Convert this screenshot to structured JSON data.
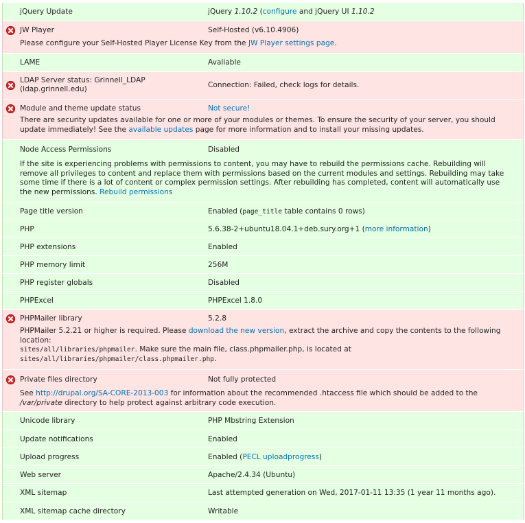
{
  "rows": [
    {
      "status": "ok",
      "title": "jQuery Update",
      "value_pre": "jQuery ",
      "value_em": "1.10.2",
      "value_link": "configure",
      "value_mid": " and jQuery UI ",
      "value_em2": "1.10.2",
      "value_open": " (",
      "value_close": ")"
    },
    {
      "status": "error",
      "title": "JW Player",
      "value": "Self-Hosted (v6.10.4906)",
      "desc_pre": "Please configure your Self-Hosted Player License Key from the ",
      "desc_link": "JW Player settings page",
      "desc_post": "."
    },
    {
      "status": "ok",
      "title": "LAME",
      "value": "Avaliable"
    },
    {
      "status": "error",
      "title_line1": "LDAP Server status: Grinnell_LDAP",
      "title_line2": "(ldap.grinnell.edu)",
      "value": "Connection: Failed, check logs for details."
    },
    {
      "status": "error",
      "title": "Module and theme update status",
      "value_link": "Not secure!",
      "desc_pre": "There are security updates available for one or more of your modules or themes. To ensure the security of your server, you should update immediately! See the ",
      "desc_link": "available updates",
      "desc_post": " page for more information and to install your missing updates."
    },
    {
      "status": "ok",
      "title": "Node Access Permissions",
      "value": "Disabled",
      "desc_pre": "If the site is experiencing problems with permissions to content, you may have to rebuild the permissions cache. Rebuilding will remove all privileges to content and replace them with permissions based on the current modules and settings. Rebuilding may take some time if there is a lot of content or complex permission settings. After rebuilding has completed, content will automatically use the new permissions. ",
      "desc_link": "Rebuild permissions"
    },
    {
      "status": "ok",
      "title": "Page title version",
      "value_pre": "Enabled (",
      "value_code": "page_title",
      "value_post": " table contains 0 rows)"
    },
    {
      "status": "ok",
      "title": "PHP",
      "value_pre": "5.6.38-2+ubuntu18.04.1+deb.sury.org+1 (",
      "value_link": "more information",
      "value_post": ")"
    },
    {
      "status": "ok",
      "title": "PHP extensions",
      "value": "Enabled"
    },
    {
      "status": "ok",
      "title": "PHP memory limit",
      "value": "256M"
    },
    {
      "status": "ok",
      "title": "PHP register globals",
      "value": "Disabled"
    },
    {
      "status": "ok",
      "title": "PHPExcel",
      "value": "PHPExcel 1.8.0"
    },
    {
      "status": "error",
      "title": "PHPMailer library",
      "value": "5.2.8",
      "desc_pre": "PHPMailer 5.2.21 or higher is required. Please ",
      "desc_link": "download the new version",
      "desc_post": ", extract the archive and copy the contents to the following location:",
      "desc_code1": "sites/all/libraries/phpmailer",
      "desc_mid": ". Make sure the main file, class.phpmailer.php, is located at",
      "desc_code2": "sites/all/libraries/phpmailer/class.phpmailer.php",
      "desc_end": "."
    },
    {
      "status": "error",
      "title": "Private files directory",
      "value": "Not fully protected",
      "desc_pre": "See ",
      "desc_link": "http://drupal.org/SA-CORE-2013-003",
      "desc_mid": " for information about the recommended .htaccess file which should be added to the ",
      "desc_em": "/var/private",
      "desc_post": " directory to help protect against arbitrary code execution."
    },
    {
      "status": "ok",
      "title": "Unicode library",
      "value": "PHP Mbstring Extension"
    },
    {
      "status": "ok",
      "title": "Update notifications",
      "value": "Enabled"
    },
    {
      "status": "ok",
      "title": "Upload progress",
      "value_pre": "Enabled (",
      "value_link": "PECL uploadprogress",
      "value_post": ")"
    },
    {
      "status": "ok",
      "title": "Web server",
      "value": "Apache/2.4.34 (Ubuntu)"
    },
    {
      "status": "ok",
      "title": "XML sitemap",
      "value": "Last attempted generation on Wed, 2017-01-11 13:35 (1 year 11 months ago)."
    },
    {
      "status": "ok",
      "title": "XML sitemap cache directory",
      "value": "Writable"
    }
  ],
  "colors": {
    "ok_bg": "#e5ffe2",
    "error_bg": "#ffe4e4",
    "link": "#0071b3",
    "error_icon": "#d62a2a"
  }
}
